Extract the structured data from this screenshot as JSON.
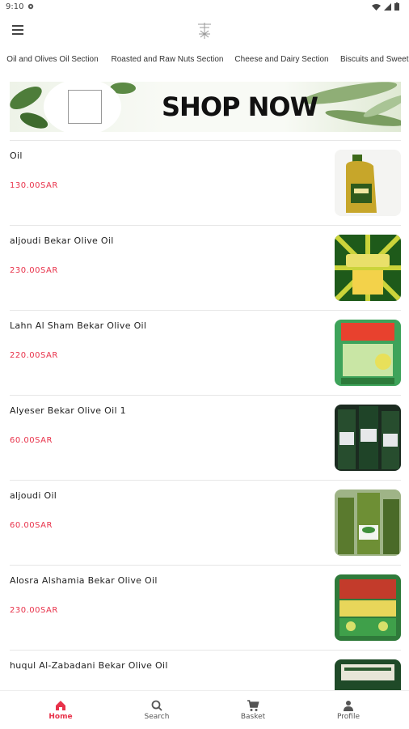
{
  "status_bar": {
    "time": "9:10"
  },
  "tabs": [
    {
      "label": "Oil and Olives Oil Section"
    },
    {
      "label": "Roasted and Raw Nuts Section"
    },
    {
      "label": "Cheese and Dairy Section"
    },
    {
      "label": "Biscuits and Sweet"
    }
  ],
  "banner": {
    "text": "SHOP NOW"
  },
  "products": [
    {
      "name": "Oil",
      "price": "130.00SAR"
    },
    {
      "name": "aljoudi Bekar Olive Oil",
      "price": "230.00SAR"
    },
    {
      "name": "Lahn Al Sham Bekar Olive Oil",
      "price": "220.00SAR"
    },
    {
      "name": "Alyeser Bekar Olive Oil 1",
      "price": "60.00SAR"
    },
    {
      "name": "aljoudi Oil",
      "price": "60.00SAR"
    },
    {
      "name": "Alosra Alshamia Bekar Olive Oil",
      "price": "230.00SAR"
    },
    {
      "name": "huqul Al-Zabadani Bekar Olive Oil",
      "price": ""
    }
  ],
  "bottom_nav": [
    {
      "label": "Home",
      "icon": "home-icon"
    },
    {
      "label": "Search",
      "icon": "search-icon"
    },
    {
      "label": "Basket",
      "icon": "cart-icon"
    },
    {
      "label": "Profile",
      "icon": "person-icon"
    }
  ],
  "colors": {
    "accent": "#e8324a",
    "tab_indicator": "#f0506e"
  }
}
